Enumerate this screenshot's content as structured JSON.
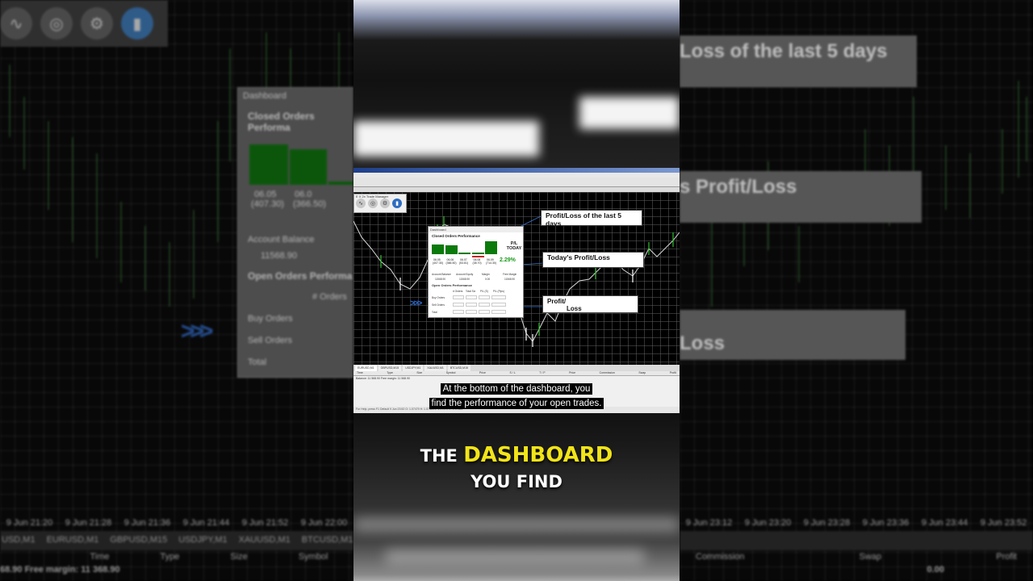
{
  "background": {
    "panels_right": [
      "Loss of the last 5 days",
      "s Profit/Loss",
      "Loss"
    ],
    "left_dashboard_title": "Dashboard",
    "left_dashboard_header": "Closed Orders Performa",
    "left_bar_labels": [
      "06.05",
      "06.0"
    ],
    "left_bar_values": [
      "(407.30)",
      "(366.50)"
    ],
    "left_balance_label": "Account Balance",
    "left_balance_value": "11568.90",
    "left_open_header": "Open Orders Performa",
    "left_orders_col": "# Orders",
    "left_rows": [
      "Buy Orders",
      "Sell Orders",
      "Total"
    ],
    "left_bottom_times": [
      "9 Jun 21:20",
      "9 Jun 21:28",
      "9 Jun 21:36",
      "9 Jun 21:44",
      "9 Jun 21:52",
      "9 Jun 22:00"
    ],
    "right_bottom_times": [
      "9 Jun 23:12",
      "9 Jun 23:20",
      "9 Jun 23:28",
      "9 Jun 23:36",
      "9 Jun 23:44",
      "9 Jun 23:52"
    ],
    "left_tabs": [
      "USD,M1",
      "EURUSD,M1",
      "GBPUSD,M15",
      "USDJPY,M1",
      "XAUUSD,M1",
      "BTCUSD,M15"
    ],
    "left_cols": [
      "Time",
      "Type",
      "Size",
      "Symbol"
    ],
    "right_cols": [
      "Commission",
      "Swap",
      "Profit"
    ],
    "left_margin_text": "68.90 Free margin: 11 368.90",
    "right_profit_value": "0.00"
  },
  "screen": {
    "trade_manager_title": "E X 2x Trade Manager",
    "dashboard": {
      "title": "Dashboard",
      "closed_header": "Closed Orders Performance",
      "bar_dates": [
        "06.05",
        "06.06",
        "06.07",
        "06.08",
        "06.09"
      ],
      "bar_values": [
        "(407.30)",
        "(366.50)",
        "(53.81)",
        "(38.70)",
        "(714.30)"
      ],
      "bar_heights_rel": [
        0.72,
        0.66,
        0.12,
        0.1,
        1.0
      ],
      "pl_label": "P/L",
      "pl_today": "TODAY",
      "pl_percent": "2.29%",
      "account_fields": [
        "Account Balance",
        "Account Equity",
        "Margin",
        "Free Margin"
      ],
      "account_values": [
        "11568.90",
        "11568.90",
        "0.00",
        "11568.90"
      ],
      "open_header": "Open Orders Performance",
      "open_cols": [
        "# Orders",
        "Total Siz",
        "P/L (S)",
        "P/L (Pips)"
      ],
      "open_rows": [
        "Buy Orders",
        "Sell Orders",
        "Total"
      ]
    },
    "callouts": {
      "last5": "Profit/Loss of the last 5 days",
      "today": "Today's Profit/Loss",
      "pl_line1": "Profit/",
      "pl_line2": "Loss"
    },
    "terminal_tabs": [
      "EURUSD,M1",
      "GBPUSD,M15",
      "USDJPY,M1",
      "XAUUSD,M1",
      "BTCUSD,M15"
    ],
    "terminal_cols": [
      "Time",
      "Type",
      "Size",
      "Symbol",
      "Price",
      "S / L",
      "T / P",
      "Price",
      "Commission",
      "Swap",
      "Profit"
    ],
    "terminal_balance": "Balance: 11 568.90 Free margin: 11 568.90",
    "status_text": "For Help, press F1        Default        9 Jun 23:52   O: 1.07479   H: 1.07483   L: 1.07479   C: 1.07483"
  },
  "subtitle": {
    "line1": "At the bottom of the dashboard, you",
    "line2": "find the performance of your open trades."
  },
  "caption": {
    "line1_a": "THE",
    "line1_b": "DASHBOARD",
    "line2": "YOU FIND"
  },
  "colors": {
    "bar_green": "#0a7a0a",
    "pl_green": "#1a9a1a",
    "caption_yellow": "#f2e418",
    "chevron_blue": "#2e6bd6"
  }
}
